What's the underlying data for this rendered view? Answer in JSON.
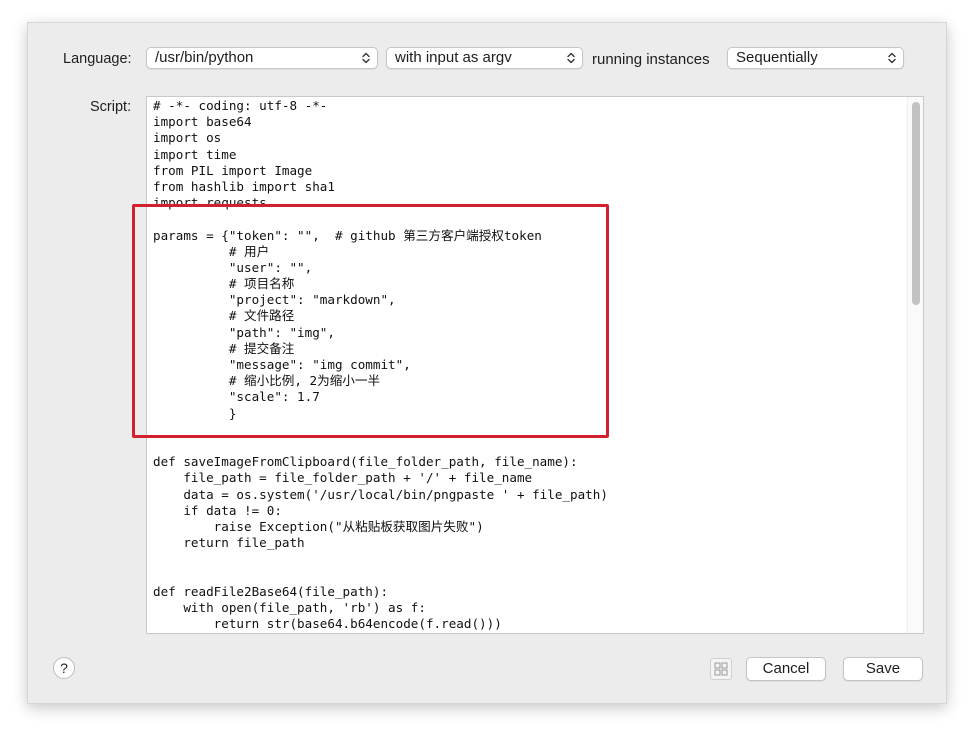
{
  "form": {
    "language_label": "Language:",
    "language_value": "/usr/bin/python",
    "input_mode_value": "with input as argv",
    "running_label": "running instances",
    "running_value": "Sequentially",
    "script_label": "Script:"
  },
  "script_lines": [
    "# -*- coding: utf-8 -*-",
    "import base64",
    "import os",
    "import time",
    "from PIL import Image",
    "from hashlib import sha1",
    "import requests",
    "",
    "params = {\"token\": \"\",  # github 第三方客户端授权token",
    "          # 用户",
    "          \"user\": \"\",",
    "          # 项目名称",
    "          \"project\": \"markdown\",",
    "          # 文件路径",
    "          \"path\": \"img\",",
    "          # 提交备注",
    "          \"message\": \"img commit\",",
    "          # 缩小比例, 2为缩小一半",
    "          \"scale\": 1.7",
    "          }",
    "",
    "",
    "def saveImageFromClipboard(file_folder_path, file_name):",
    "    file_path = file_folder_path + '/' + file_name",
    "    data = os.system('/usr/local/bin/pngpaste ' + file_path)",
    "    if data != 0:",
    "        raise Exception(\"从粘贴板获取图片失败\")",
    "    return file_path",
    "",
    "",
    "def readFile2Base64(file_path):",
    "    with open(file_path, 'rb') as f:",
    "        return str(base64.b64encode(f.read()))"
  ],
  "footer": {
    "help_label": "?",
    "cancel_label": "Cancel",
    "save_label": "Save"
  },
  "colors": {
    "highlight": "#d2202f",
    "sheet_background": "#ececec"
  },
  "icons": [
    "help-icon",
    "grid-view-icon",
    "popup-arrows-icon"
  ]
}
